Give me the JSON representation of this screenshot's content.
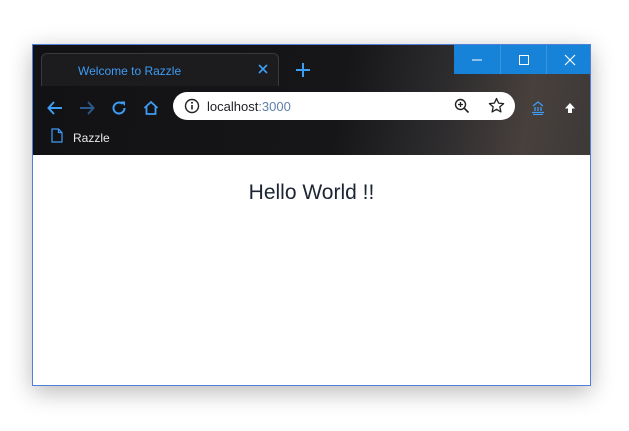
{
  "browser": {
    "tab": {
      "title": "Welcome to Razzle",
      "close_icon": "close-icon"
    },
    "new_tab_icon": "plus-icon",
    "window_controls": [
      "minimize-icon",
      "maximize-icon",
      "close-icon"
    ],
    "toolbar": {
      "back_icon": "arrow-left-icon",
      "forward_icon": "arrow-right-icon",
      "reload_icon": "reload-icon",
      "home_icon": "home-icon",
      "extension_icon": "extension-icon",
      "update_icon": "arrow-up-icon"
    },
    "omnibox": {
      "info_icon": "info-icon",
      "host": "localhost",
      "port": ":3000",
      "zoom_icon": "zoom-in-icon",
      "star_icon": "star-icon"
    },
    "bookmarks": [
      {
        "label": "Razzle",
        "icon": "page-icon"
      }
    ],
    "colors": {
      "accent": "#3d9cf4",
      "titlebar_button": "#1683d8",
      "toolbar_bg": "#121214",
      "page_bg": "#ffffff",
      "window_border": "#4f7fd6"
    }
  },
  "page": {
    "heading": "Hello World !!"
  }
}
